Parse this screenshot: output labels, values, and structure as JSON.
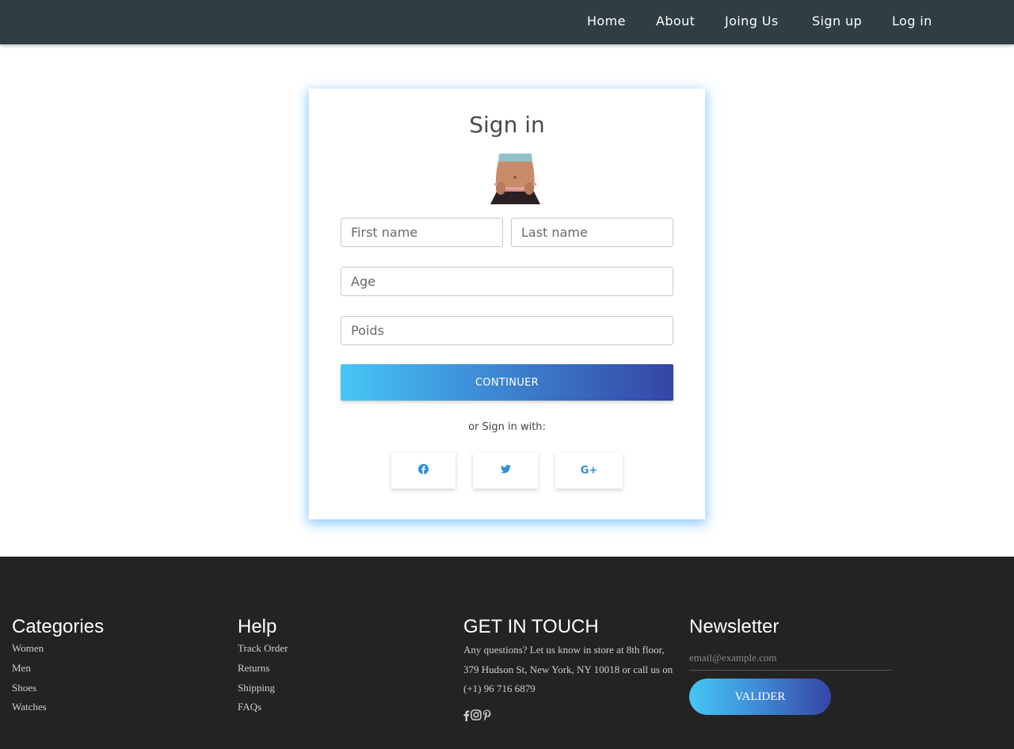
{
  "nav": {
    "home": "Home",
    "about": "About",
    "joining": "Joing Us",
    "signup": "Sign up",
    "login": "Log in"
  },
  "card": {
    "title": "Sign in",
    "first_name_placeholder": "First name",
    "last_name_placeholder": "Last name",
    "age_placeholder": "Age",
    "poids_placeholder": "Poids",
    "continue_label": "CONTINUER",
    "or_text": "or Sign in with:",
    "social": {
      "facebook": "f",
      "twitter": "t",
      "google": "G+"
    }
  },
  "footer": {
    "categories": {
      "title": "Categories",
      "items": [
        "Women",
        "Men",
        "Shoes",
        "Watches"
      ]
    },
    "help": {
      "title": "Help",
      "items": [
        "Track Order",
        "Returns",
        "Shipping",
        "FAQs"
      ]
    },
    "touch": {
      "title": "GET IN TOUCH",
      "text": "Any questions? Let us know in store at 8th floor, 379 Hudson St, New York, NY 10018 or call us on (+1) 96 716 6879"
    },
    "newsletter": {
      "title": "Newsletter",
      "placeholder": "email@example.com",
      "button": "VALIDER"
    }
  },
  "colors": {
    "nav_bg": "#2e3e44",
    "footer_bg": "#232323",
    "gradient_start": "#46c6f5",
    "gradient_end": "#3545a6",
    "social_icon": "#2b8fe0"
  }
}
